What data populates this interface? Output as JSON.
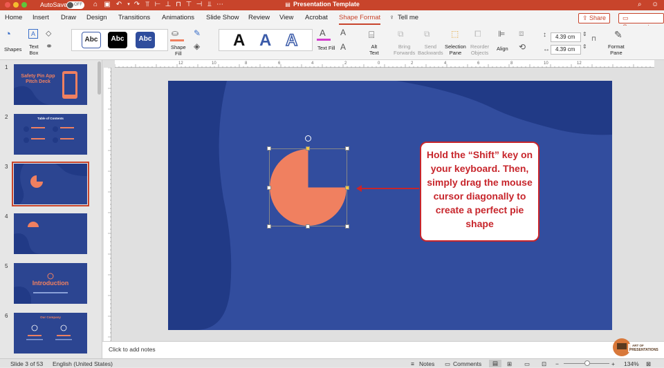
{
  "titlebar": {
    "autosave": "AutoSave",
    "autosave_state": "OFF",
    "doc_title": "Presentation Template",
    "qa_icons": [
      "home-icon",
      "save-icon",
      "undo-icon",
      "redo-icon",
      "align-icon"
    ]
  },
  "tabs": [
    {
      "label": "Home",
      "active": false
    },
    {
      "label": "Insert",
      "active": false
    },
    {
      "label": "Draw",
      "active": false
    },
    {
      "label": "Design",
      "active": false
    },
    {
      "label": "Transitions",
      "active": false
    },
    {
      "label": "Animations",
      "active": false
    },
    {
      "label": "Slide Show",
      "active": false
    },
    {
      "label": "Review",
      "active": false
    },
    {
      "label": "View",
      "active": false
    },
    {
      "label": "Acrobat",
      "active": false
    },
    {
      "label": "Shape Format",
      "active": true
    }
  ],
  "tell_me": "Tell me",
  "share": "Share",
  "comments": "Comments",
  "ribbon": {
    "shapes": "Shapes",
    "text_box": "Text\nBox",
    "style_samples": [
      "Abc",
      "Abc",
      "Abc"
    ],
    "shape_fill": "Shape\nFill",
    "wordart_letters": [
      "A",
      "A",
      "A"
    ],
    "text_fill": "Text Fill",
    "alt_text": "Alt\nText",
    "bring_forwards": "Bring\nForwards",
    "send_backwards": "Send\nBackwards",
    "selection_pane": "Selection\nPane",
    "reorder_objects": "Reorder\nObjects",
    "align": "Align",
    "height": "4.39 cm",
    "width": "4.39 cm",
    "format_pane": "Format\nPane"
  },
  "ruler_labels": [
    "12",
    "10",
    "8",
    "6",
    "4",
    "2",
    "0",
    "2",
    "4",
    "6",
    "8",
    "10",
    "12"
  ],
  "slides": [
    {
      "num": "1",
      "title": "Safety Pin App\nPitch Deck"
    },
    {
      "num": "2",
      "title": "Table of Contents"
    },
    {
      "num": "3",
      "title": ""
    },
    {
      "num": "4",
      "title": ""
    },
    {
      "num": "5",
      "title": "Introduction"
    },
    {
      "num": "6",
      "title": "Our Company"
    }
  ],
  "callout": "Hold the “Shift” key on your keyboard. Then, simply drag the mouse cursor diagonally to create a perfect pie shape",
  "notes_placeholder": "Click to add notes",
  "status": {
    "slide_info": "Slide 3 of 53",
    "language": "English (United States)",
    "notes": "Notes",
    "comments": "Comments",
    "zoom": "134%"
  },
  "logo_text": "ART OF\nPRESENTATIONS",
  "colors": {
    "accent": "#c8442b",
    "slide_bg": "#324d9e",
    "slide_dark": "#213a86",
    "pie": "#f08060",
    "callout_red": "#c7252b"
  }
}
